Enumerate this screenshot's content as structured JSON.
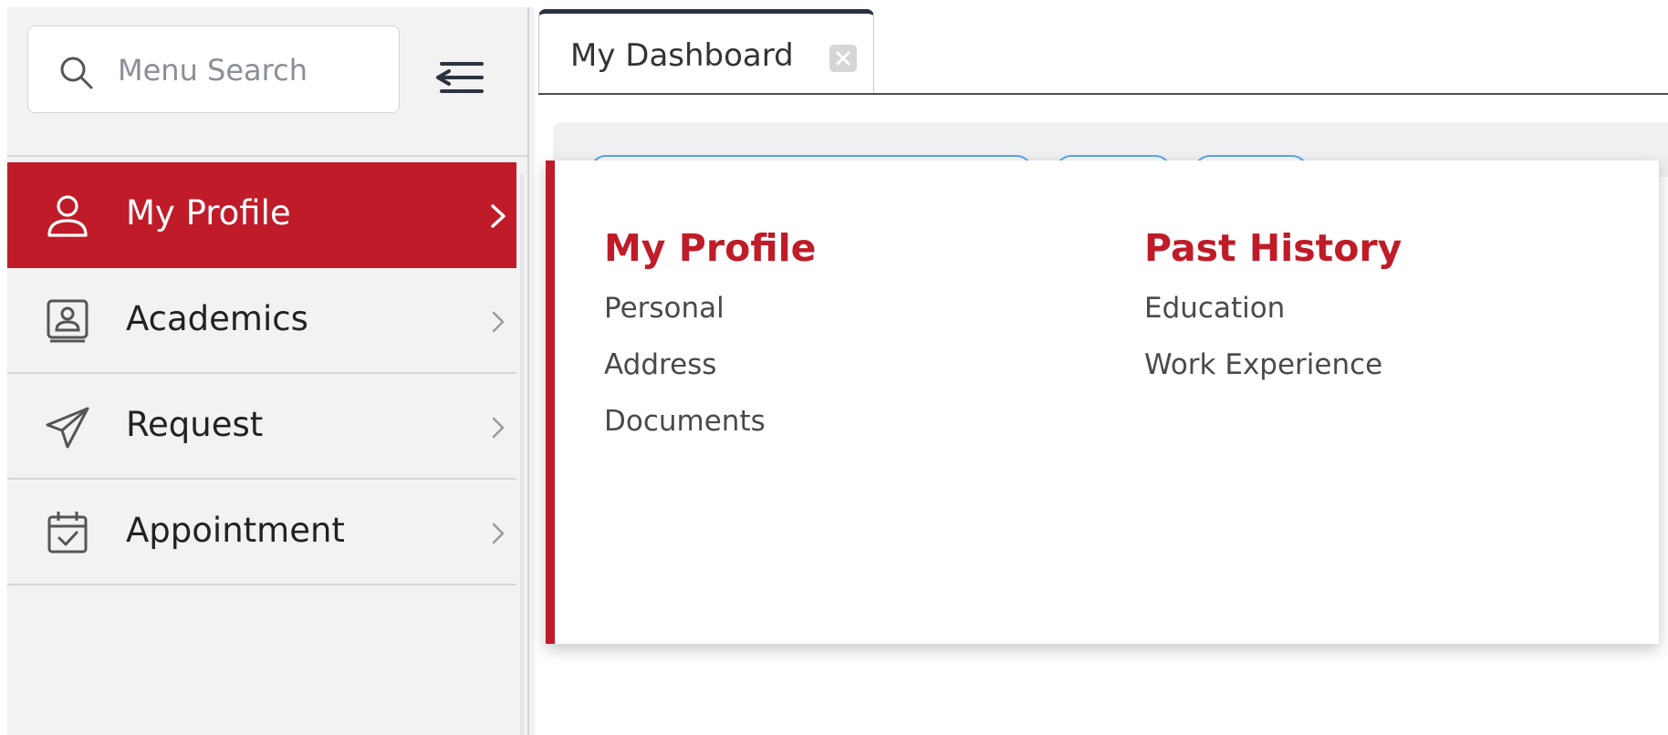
{
  "search": {
    "placeholder": "Menu Search",
    "value": ""
  },
  "sidebar": {
    "items": [
      {
        "label": "My Profile",
        "icon": "user-icon",
        "active": true
      },
      {
        "label": "Academics",
        "icon": "id-card-icon",
        "active": false
      },
      {
        "label": "Request",
        "icon": "paper-plane-icon",
        "active": false
      },
      {
        "label": "Appointment",
        "icon": "calendar-check-icon",
        "active": false
      }
    ]
  },
  "tabs": [
    {
      "label": "My Dashboard"
    }
  ],
  "mega_menu": {
    "columns": [
      {
        "heading": "My Profile",
        "links": [
          "Personal",
          "Address",
          "Documents"
        ]
      },
      {
        "heading": "Past History",
        "links": [
          "Education",
          "Work Experience"
        ]
      }
    ]
  },
  "colors": {
    "accent": "#c01b28",
    "sidebar_bg": "#f2f2f2",
    "tab_top_border": "#2b3240"
  }
}
